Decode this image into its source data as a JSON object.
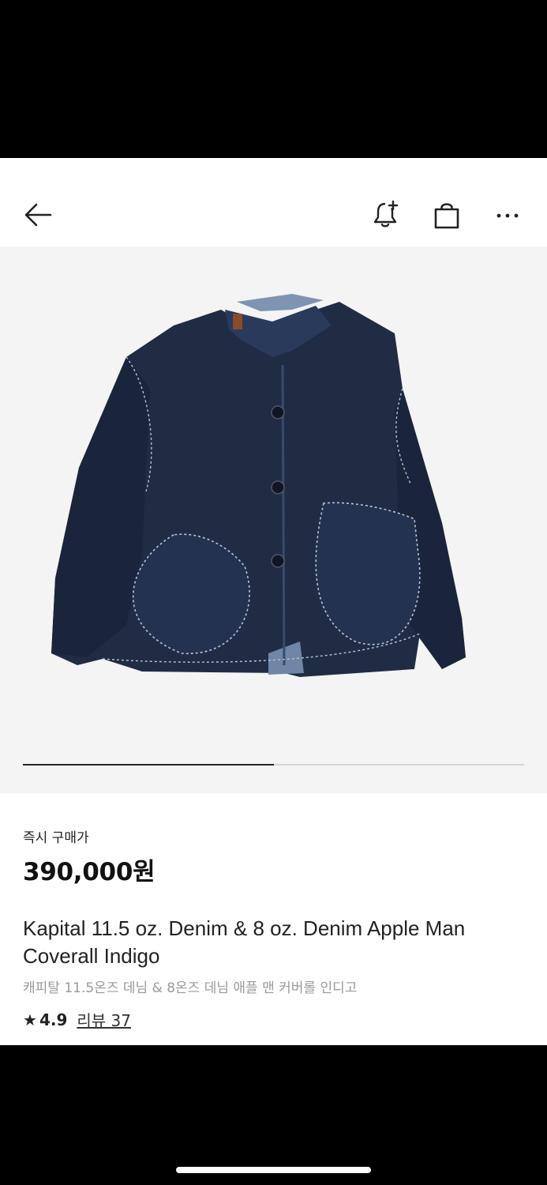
{
  "header": {
    "back_icon": "arrow-left-icon",
    "notify_icon": "bell-plus-icon",
    "cart_icon": "shopping-bag-icon",
    "more_icon": "more-horizontal-icon"
  },
  "gallery": {
    "image_subject": "denim-coverall-jacket",
    "progress": 0.5
  },
  "product": {
    "price_label": "즉시 구매가",
    "price": "390,000원",
    "title_en": "Kapital 11.5 oz. Denim & 8 oz. Denim Apple Man Coverall Indigo",
    "title_ko": "캐피탈 11.5온즈 데님 & 8온즈 데님 애플 맨 커버롤 인디고",
    "rating_star": "★",
    "rating": "4.9",
    "review_text": "리뷰 37"
  },
  "colors": {
    "accent": "#111111",
    "secondary_text": "#9a9a9a",
    "image_bg": "#f4f4f4",
    "denim": "#1f2c44"
  }
}
